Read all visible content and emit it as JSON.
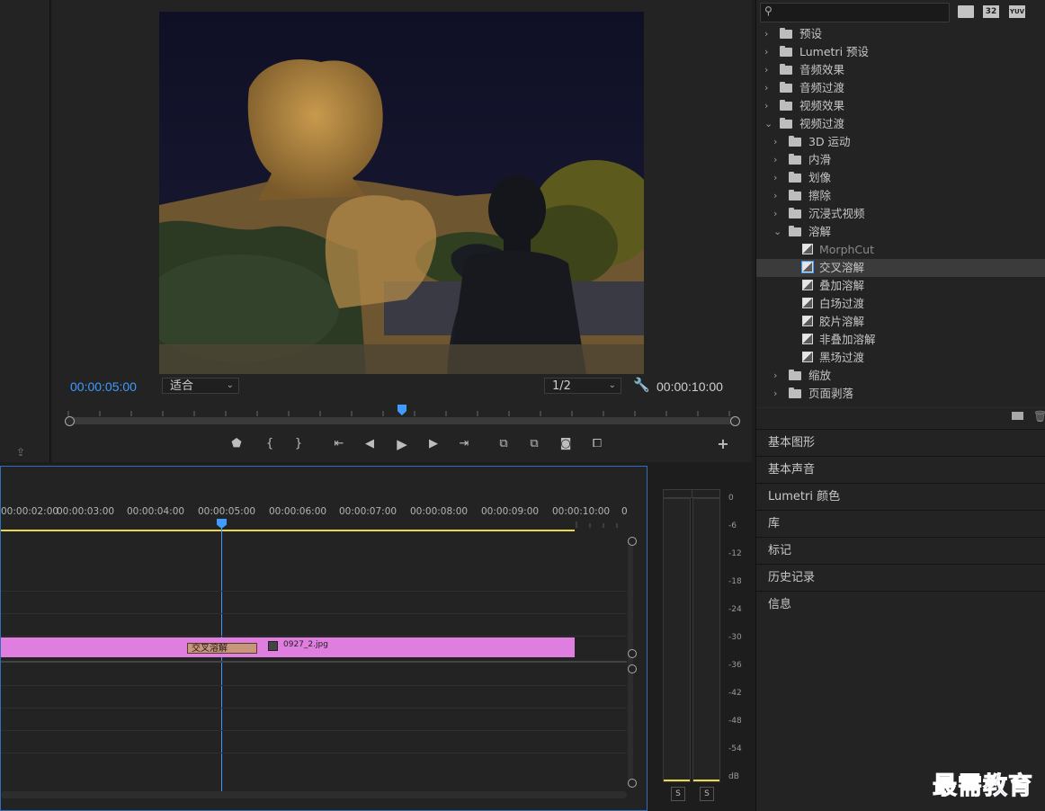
{
  "monitor": {
    "current_time": "00:00:05:00",
    "fit_select": "适合",
    "resolution_select": "1/2",
    "duration": "00:00:10:00"
  },
  "effects": {
    "search_placeholder": "",
    "header_icons": [
      "accelerated-effects-icon",
      "32-bit-icon",
      "yuv-icon"
    ],
    "header_icon_labels": [
      "",
      "32",
      "YUV"
    ],
    "tree": [
      {
        "label": "预设",
        "level": 0,
        "type": "preset-folder",
        "expanded": false
      },
      {
        "label": "Lumetri 预设",
        "level": 0,
        "type": "preset-folder",
        "expanded": false
      },
      {
        "label": "音频效果",
        "level": 0,
        "type": "folder",
        "expanded": false
      },
      {
        "label": "音频过渡",
        "level": 0,
        "type": "folder",
        "expanded": false
      },
      {
        "label": "视频效果",
        "level": 0,
        "type": "folder",
        "expanded": false
      },
      {
        "label": "视频过渡",
        "level": 0,
        "type": "folder",
        "expanded": true
      },
      {
        "label": "3D 运动",
        "level": 1,
        "type": "folder",
        "expanded": false
      },
      {
        "label": "内滑",
        "level": 1,
        "type": "folder",
        "expanded": false
      },
      {
        "label": "划像",
        "level": 1,
        "type": "folder",
        "expanded": false
      },
      {
        "label": "擦除",
        "level": 1,
        "type": "folder",
        "expanded": false
      },
      {
        "label": "沉浸式视频",
        "level": 1,
        "type": "folder",
        "expanded": false
      },
      {
        "label": "溶解",
        "level": 1,
        "type": "folder",
        "expanded": true
      },
      {
        "label": "MorphCut",
        "level": 2,
        "type": "transition",
        "dim": true
      },
      {
        "label": "交叉溶解",
        "level": 2,
        "type": "transition",
        "selected": true
      },
      {
        "label": "叠加溶解",
        "level": 2,
        "type": "transition"
      },
      {
        "label": "白场过渡",
        "level": 2,
        "type": "transition"
      },
      {
        "label": "胶片溶解",
        "level": 2,
        "type": "transition"
      },
      {
        "label": "非叠加溶解",
        "level": 2,
        "type": "transition"
      },
      {
        "label": "黑场过渡",
        "level": 2,
        "type": "transition"
      },
      {
        "label": "缩放",
        "level": 1,
        "type": "folder",
        "expanded": false
      },
      {
        "label": "页面剥落",
        "level": 1,
        "type": "folder",
        "expanded": false
      }
    ]
  },
  "panels": [
    "基本图形",
    "基本声音",
    "Lumetri 颜色",
    "库",
    "标记",
    "历史记录",
    "信息"
  ],
  "timeline": {
    "ruler_labels": [
      "00:00:02:00",
      "00:00:03:00",
      "00:00:04:00",
      "00:00:05:00",
      "00:00:06:00",
      "00:00:07:00",
      "00:00:08:00",
      "00:00:09:00",
      "00:00:10:00",
      "0"
    ],
    "transition_label": "交叉溶解",
    "clip_name": "0927_2.jpg",
    "clip_color": "#e07ee0"
  },
  "meter": {
    "db_labels": [
      "0",
      "-6",
      "-12",
      "-18",
      "-24",
      "-30",
      "-36",
      "-42",
      "-48",
      "-54",
      "dB"
    ],
    "solo_buttons": [
      "S",
      "S"
    ]
  },
  "watermark": "最需教育",
  "colors": {
    "accent_blue": "#2d8ceb",
    "timecode_blue": "#3f9bff",
    "work_area_yellow": "#e8d84a"
  }
}
